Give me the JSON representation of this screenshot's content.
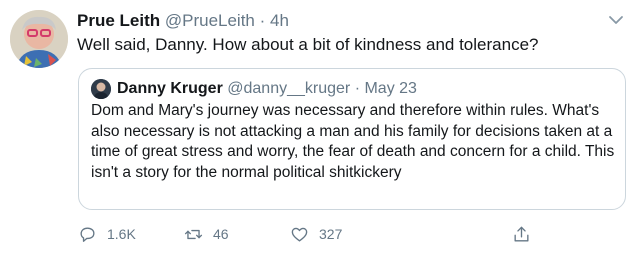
{
  "tweet": {
    "author_name": "Prue Leith",
    "author_handle": "@PrueLeith",
    "separator": "·",
    "time": "4h",
    "text": "Well said, Danny. How about a bit of kindness and tolerance?"
  },
  "quoted": {
    "author_name": "Danny Kruger",
    "author_handle": "@danny__kruger",
    "separator": "·",
    "date": "May 23",
    "text": "Dom and Mary's journey was necessary and therefore within rules. What's also necessary is not attacking a man and his family for decisions taken at a time of great stress and worry, the fear of death and concern for a child. This isn't a story for the normal political shitkickery"
  },
  "actions": {
    "replies": "1.6K",
    "retweets": "46",
    "likes": "327"
  },
  "icons": {
    "reply": "reply-icon",
    "retweet": "retweet-icon",
    "like": "heart-icon",
    "share": "share-icon",
    "menu": "chevron-down-icon"
  },
  "colors": {
    "text": "#14171a",
    "secondary": "#657786",
    "border": "#ccd6dd"
  }
}
